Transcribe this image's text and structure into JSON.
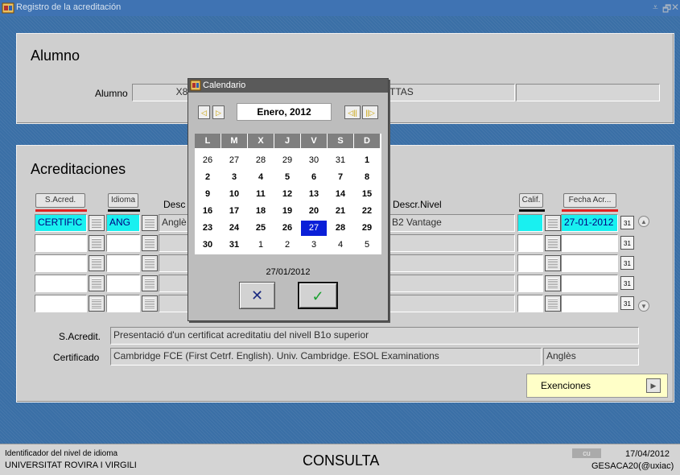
{
  "window": {
    "title": "Registro de la acreditación",
    "controls": [
      "⩡",
      "🗗",
      "✕"
    ]
  },
  "alumno": {
    "heading": "Alumno",
    "label": "Alumno",
    "id_value": "X84",
    "name_value": "TTAS",
    "extra_value": ""
  },
  "acreditaciones": {
    "heading": "Acreditaciones",
    "headers": {
      "s_acred": "S.Acred.",
      "idioma": "Idioma",
      "desc": "Desc",
      "descr_nivel": "Descr.Nivel",
      "calif": "Calif.",
      "fecha": "Fecha Acr..."
    },
    "rows": [
      {
        "s_acred": "CERTIFIC",
        "idioma": "ANG",
        "desc": "Anglè",
        "descr_nivel": "B2 Vantage",
        "calif": "",
        "fecha": "27-01-2012"
      },
      {
        "s_acred": "",
        "idioma": "",
        "desc": "",
        "descr_nivel": "",
        "calif": "",
        "fecha": ""
      },
      {
        "s_acred": "",
        "idioma": "",
        "desc": "",
        "descr_nivel": "",
        "calif": "",
        "fecha": ""
      },
      {
        "s_acred": "",
        "idioma": "",
        "desc": "",
        "descr_nivel": "",
        "calif": "",
        "fecha": ""
      },
      {
        "s_acred": "",
        "idioma": "",
        "desc": "",
        "descr_nivel": "",
        "calif": "",
        "fecha": ""
      }
    ],
    "cal_icon": "31",
    "s_acredit_label": "S.Acredit.",
    "s_acredit_value": "Presentació d'un certificat acreditatiu del nivell B1o superior",
    "certificado_label": "Certificado",
    "certificado_value": "Cambridge FCE (First Cetrf. English). Univ. Cambridge. ESOL Examinations",
    "certificado_lang": "Anglès",
    "exenciones_label": "Exenciones"
  },
  "calendar": {
    "title": "Calendario",
    "month": "Enero, 2012",
    "nav": [
      "◁",
      "▷",
      "◁||",
      "||▷"
    ],
    "weekdays": [
      "L",
      "M",
      "X",
      "J",
      "V",
      "S",
      "D"
    ],
    "weeks": [
      [
        "26",
        "27",
        "28",
        "29",
        "30",
        "31",
        "1"
      ],
      [
        "2",
        "3",
        "4",
        "5",
        "6",
        "7",
        "8"
      ],
      [
        "9",
        "10",
        "11",
        "12",
        "13",
        "14",
        "15"
      ],
      [
        "16",
        "17",
        "18",
        "19",
        "20",
        "21",
        "22"
      ],
      [
        "23",
        "24",
        "25",
        "26",
        "27",
        "28",
        "29"
      ],
      [
        "30",
        "31",
        "1",
        "2",
        "3",
        "4",
        "5"
      ]
    ],
    "selected": "27",
    "selected_date": "27/01/2012",
    "cancel_label": "✕",
    "ok_label": "✓"
  },
  "status": {
    "left_line1": "Identificador del nivel de idioma",
    "left_line2": "UNIVERSITAT ROVIRA I VIRGILI",
    "mode": "CONSULTA",
    "badge": "cu",
    "date": "17/04/2012",
    "user": "GESACA20(@uxiac)"
  },
  "colors": {
    "accent_cyan": "#19f0f0",
    "title_blue": "#3f73b3",
    "selected_day": "#0a1fd8",
    "exenciones_bg": "#ffffc8"
  }
}
